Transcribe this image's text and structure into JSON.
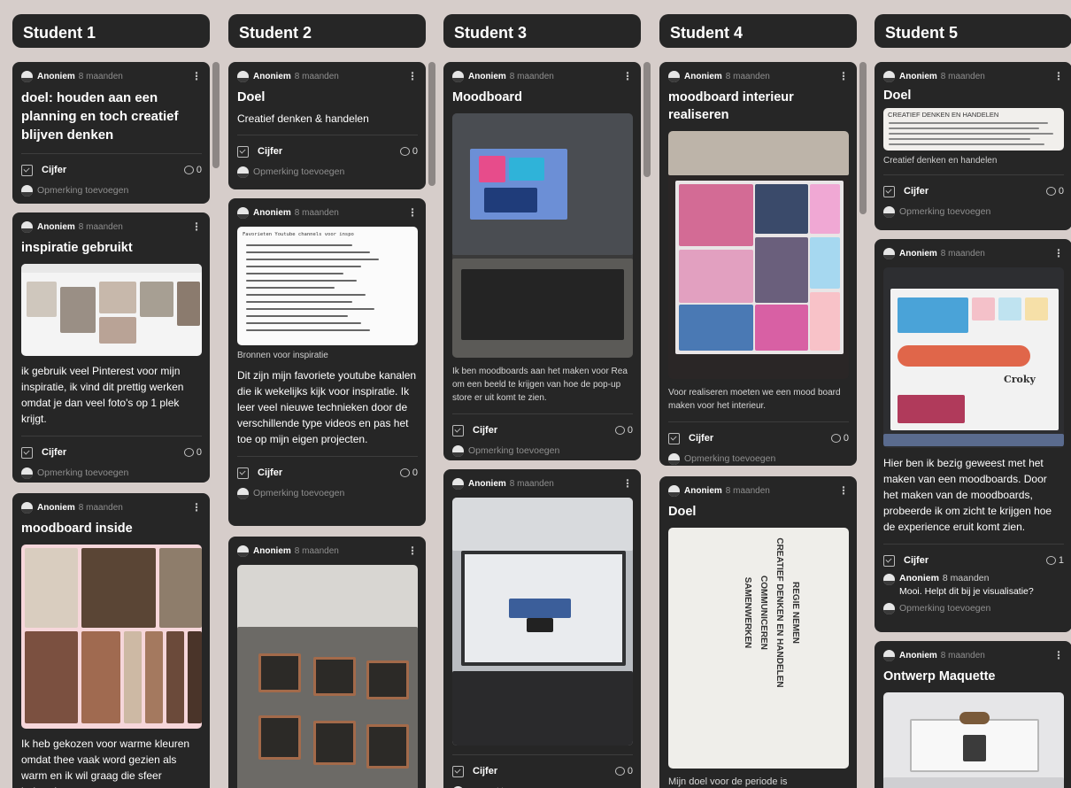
{
  "columns": [
    {
      "title": "Student 1"
    },
    {
      "title": "Student 2"
    },
    {
      "title": "Student 3"
    },
    {
      "title": "Student 4"
    },
    {
      "title": "Student 5"
    }
  ],
  "common": {
    "author": "Anoniem",
    "time": "8 maanden",
    "grade_label": "Cijfer",
    "add_comment": "Opmerking toevoegen",
    "kebab": "⋮"
  },
  "cards": {
    "s1c1": {
      "title": "doel: houden aan een planning en toch creatief blijven denken",
      "comments": "0"
    },
    "s1c2": {
      "title": "inspiratie gebruikt",
      "body": "ik gebruik veel Pinterest voor mijn inspiratie, ik vind dit prettig werken omdat je dan veel foto's op 1 plek krijgt.",
      "comments": "0"
    },
    "s1c3": {
      "title": "moodboard inside",
      "body": "Ik heb gekozen voor warme kleuren omdat thee vaak word gezien als warm en ik wil graag die sfeer behouden."
    },
    "s2c1": {
      "title": "Doel",
      "subtitle": "Creatief denken & handelen",
      "comments": "0"
    },
    "s2c2": {
      "caption": "Bronnen voor inspiratie",
      "body": "Dit zijn mijn favoriete youtube kanalen die ik wekelijks kijk voor inspiratie. Ik leer veel nieuwe technieken door de verschillende type videos en pas het toe op mijn eigen projecten.",
      "comments": "0"
    },
    "s2c3": {},
    "s3c1": {
      "title": "Moodboard",
      "body": "Ik ben moodboards aan het maken voor Rea om een beeld te krijgen van hoe de pop-up store er uit komt te zien.",
      "comments": "0"
    },
    "s3c2": {
      "comments": "0"
    },
    "s4c1": {
      "title": "moodboard interieur realiseren",
      "body": "Voor realiseren moeten we een mood board maken voor het interieur.",
      "comments": "0"
    },
    "s4c2": {
      "title": "Doel",
      "body": "Mijn doel voor de periode is"
    },
    "s5c1": {
      "title": "Doel",
      "caption": "Creatief denken en handelen",
      "comments": "0"
    },
    "s5c2": {
      "body": "Hier ben ik bezig geweest met het maken van een moodboards. Door het maken van de moodboards, probeerde ik om zicht te krijgen hoe de experience eruit komt zien.",
      "comments": "1",
      "reply_author": "Anoniem",
      "reply_time": "8 maanden",
      "reply_text": "Mooi. Helpt dit bij je visualisatie?"
    },
    "s5c3": {
      "title": "Ontwerp Maquette"
    }
  },
  "image_texts": {
    "doel_sheet_heading": "CREATIEF DENKEN EN HANDELEN",
    "youtube_list_heading": "Favorieten Youtube channels voor inspo",
    "croky_label": "Croky",
    "doel_sheet_headings": [
      "REGIE NEMEN",
      "CREATIEF DENKEN EN HANDELEN",
      "COMMUNICEREN",
      "SAMENWERKEN"
    ]
  },
  "colors": {
    "board_background": "#d6cdca",
    "card": "#262626",
    "meta_gray": "#8f8f8f"
  }
}
